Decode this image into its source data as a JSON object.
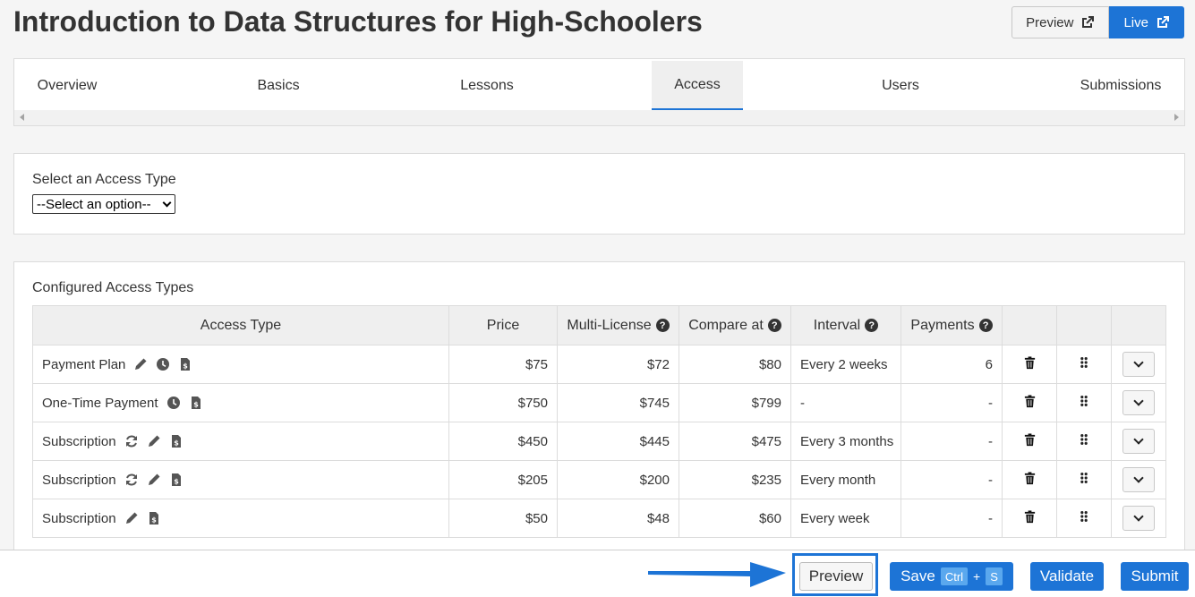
{
  "header": {
    "title": "Introduction to Data Structures for High-Schoolers",
    "preview_label": "Preview",
    "live_label": "Live"
  },
  "tabs": [
    {
      "label": "Overview"
    },
    {
      "label": "Basics"
    },
    {
      "label": "Lessons"
    },
    {
      "label": "Access",
      "active": true
    },
    {
      "label": "Users"
    },
    {
      "label": "Submissions"
    }
  ],
  "access_select": {
    "label": "Select an Access Type",
    "selected": "--Select an option--"
  },
  "configured": {
    "label": "Configured Access Types",
    "columns": [
      "Access Type",
      "Price",
      "Multi-License",
      "Compare at",
      "Interval",
      "Payments"
    ],
    "rows": [
      {
        "type": "Payment Plan",
        "icons": [
          "pencil-icon",
          "clock-icon",
          "invoice-icon"
        ],
        "price": "$75",
        "multi": "$72",
        "compare": "$80",
        "interval": "Every 2 weeks",
        "payments": "6"
      },
      {
        "type": "One-Time Payment",
        "icons": [
          "clock-icon",
          "invoice-icon"
        ],
        "price": "$750",
        "multi": "$745",
        "compare": "$799",
        "interval": "-",
        "payments": "-"
      },
      {
        "type": "Subscription",
        "icons": [
          "sync-icon",
          "pencil-icon",
          "invoice-icon"
        ],
        "price": "$450",
        "multi": "$445",
        "compare": "$475",
        "interval": "Every 3 months",
        "payments": "-"
      },
      {
        "type": "Subscription",
        "icons": [
          "sync-icon",
          "pencil-icon",
          "invoice-icon"
        ],
        "price": "$205",
        "multi": "$200",
        "compare": "$235",
        "interval": "Every month",
        "payments": "-"
      },
      {
        "type": "Subscription",
        "icons": [
          "pencil-icon",
          "invoice-icon"
        ],
        "price": "$50",
        "multi": "$48",
        "compare": "$60",
        "interval": "Every week",
        "payments": "-"
      }
    ]
  },
  "footer": {
    "preview_label": "Preview",
    "save_label": "Save",
    "ctrl_key": "Ctrl",
    "plus": "+",
    "s_key": "S",
    "validate_label": "Validate",
    "submit_label": "Submit"
  },
  "colors": {
    "accent": "#1d74d6",
    "table_header_bg": "#efefef"
  }
}
